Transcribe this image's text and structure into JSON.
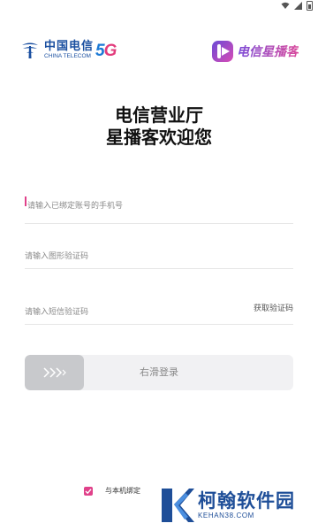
{
  "status_bar": {
    "icons": [
      "wifi-icon",
      "signal-icon",
      "battery-icon"
    ]
  },
  "logos": {
    "carrier_cn": "中国电信",
    "carrier_en": "CHINA TELECOM",
    "badge_5g": "5G",
    "app_brand": "电信星播客"
  },
  "header": {
    "line1": "电信营业厅",
    "line2": "星播客欢迎您"
  },
  "form": {
    "phone_placeholder": "请输入已绑定账号的手机号",
    "captcha_placeholder": "请输入图形验证码",
    "sms_placeholder": "请输入短信验证码",
    "get_code_label": "获取验证码",
    "slider_label": "右滑登录"
  },
  "agreement": {
    "label": "与本机绑定",
    "checked": true
  },
  "watermark": {
    "name": "柯翰软件园",
    "url": "KEHAN38.COM"
  },
  "colors": {
    "accent": "#e0418a",
    "telecom_blue": "#1a4fa0",
    "slider_handle": "#c8c9cc",
    "slider_track": "#f1f1f3"
  }
}
